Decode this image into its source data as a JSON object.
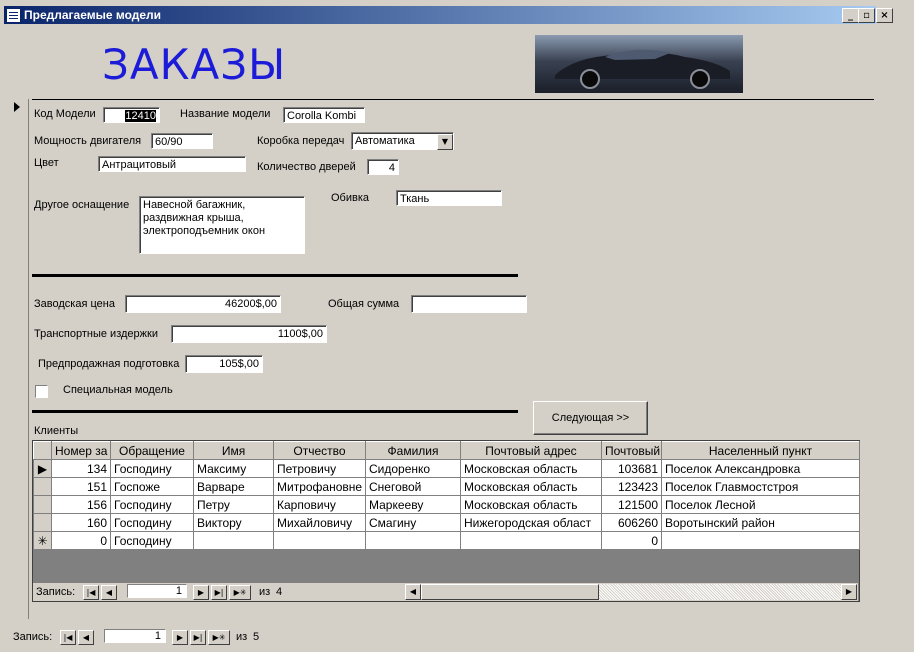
{
  "window": {
    "title": "Предлагаемые модели",
    "minimize_icon": "minimize-icon",
    "restore_icon": "restore-icon",
    "close_icon": "close-icon"
  },
  "header": {
    "logo_text": "ЗАКАЗЫ",
    "image": "car-photo"
  },
  "form": {
    "model_code_label": "Код Модели",
    "model_code_value": "12410",
    "model_name_label": "Название модели",
    "model_name_value": "Corolla Kombi",
    "engine_power_label": "Мощность двигателя",
    "engine_power_value": "60/90",
    "gearbox_label": "Коробка передач",
    "gearbox_value": "Автоматика",
    "color_label": "Цвет",
    "color_value": "Антрацитовый",
    "doors_label": "Количество дверей",
    "doors_value": "4",
    "other_equipment_label": "Другое оснащение",
    "other_equipment_lines": [
      "Навесной багажник,",
      "раздвижная крыша,",
      "электроподъемник окон"
    ],
    "upholstery_label": "Обивка",
    "upholstery_value": "Ткань",
    "factory_price_label": "Заводская цена",
    "factory_price_value": "46200$,00",
    "total_label": "Общая сумма",
    "total_value": "",
    "transport_label": "Транспортные издержки",
    "transport_value": "1100$,00",
    "presale_label": "Предпродажная подготовка",
    "presale_value": "105$,00",
    "special_label": "Специальная модель",
    "special_checked": false,
    "next_button": "Следующая >>"
  },
  "clients": {
    "label": "Клиенты",
    "columns": [
      "Номер за",
      "Обращение",
      "Имя",
      "Отчество",
      "Фамилия",
      "Почтовый адрес",
      "Почтовый",
      "Населенный пункт"
    ],
    "rows": [
      [
        "134",
        "Господину",
        "Максиму",
        "Петровичу",
        "Сидоренко",
        "Московская область",
        "103681",
        "Поселок Александровка"
      ],
      [
        "151",
        "Госпоже",
        "Варваре",
        "Митрофановне",
        "Снеговой",
        "Московская область",
        "123423",
        "Поселок Главмостстроя"
      ],
      [
        "156",
        "Господину",
        "Петру",
        "Карповичу",
        "Маркееву",
        "Московская область",
        "121500",
        "Поселок Лесной"
      ],
      [
        "160",
        "Господину",
        "Виктору",
        "Михайловичу",
        "Смагину",
        "Нижегородская област",
        "606260",
        "Воротынский район"
      ],
      [
        "0",
        "Господину",
        "",
        "",
        "",
        "",
        "0",
        ""
      ]
    ],
    "nav": {
      "record_label": "Запись:",
      "current": "1",
      "of_label": "из",
      "total": "4"
    }
  },
  "main_nav": {
    "record_label": "Запись:",
    "current": "1",
    "of_label": "из",
    "total": "5"
  }
}
